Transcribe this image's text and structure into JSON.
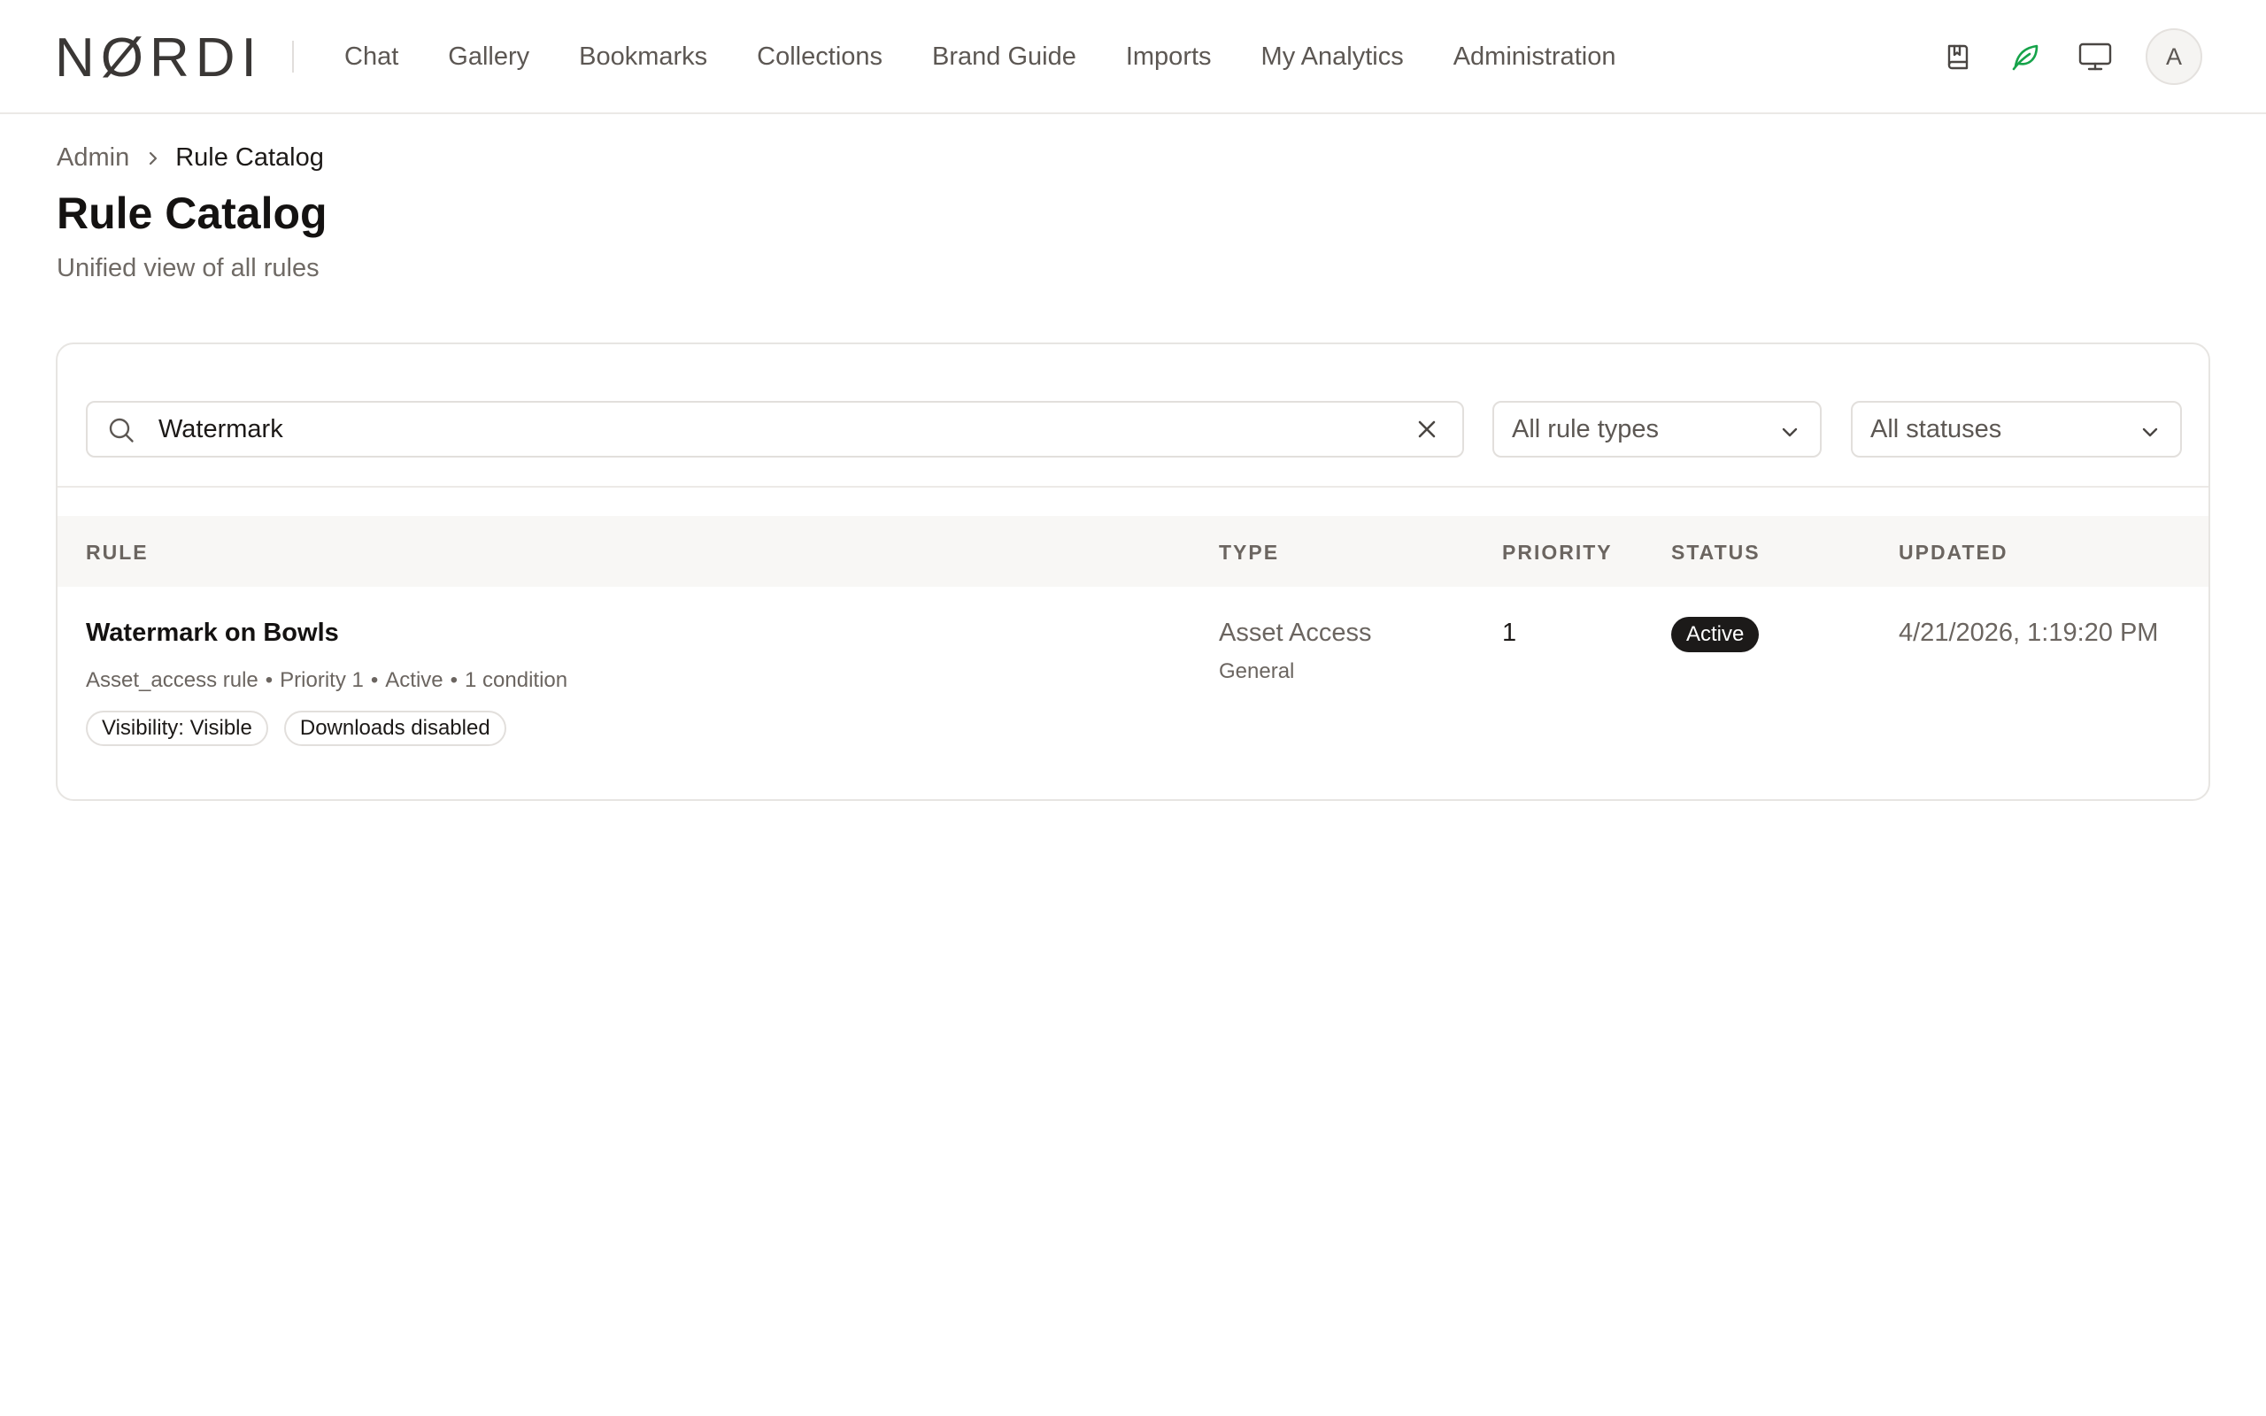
{
  "header": {
    "logo": "NØRDI",
    "nav": [
      "Chat",
      "Gallery",
      "Bookmarks",
      "Collections",
      "Brand Guide",
      "Imports",
      "My Analytics",
      "Administration"
    ],
    "icons": [
      "bookmark-book-icon",
      "leaf-icon",
      "monitor-icon"
    ],
    "avatar_initial": "A",
    "accent_color": "#16a34a"
  },
  "breadcrumb": {
    "parent": "Admin",
    "current": "Rule Catalog"
  },
  "page": {
    "title": "Rule Catalog",
    "subtitle": "Unified view of all rules"
  },
  "filters": {
    "search_value": "Watermark",
    "rule_type": "All rule types",
    "status": "All statuses"
  },
  "table": {
    "headers": {
      "rule": "RULE",
      "type": "TYPE",
      "priority": "PRIORITY",
      "status": "STATUS",
      "updated": "UPDATED"
    },
    "rows": [
      {
        "name": "Watermark on Bowls",
        "meta": [
          "Asset_access rule",
          "Priority 1",
          "Active",
          "1 condition"
        ],
        "tags": [
          "Visibility: Visible",
          "Downloads disabled"
        ],
        "type": "Asset Access",
        "type_sub": "General",
        "priority": "1",
        "status": "Active",
        "updated": "4/21/2026, 1:19:20 PM"
      }
    ]
  }
}
